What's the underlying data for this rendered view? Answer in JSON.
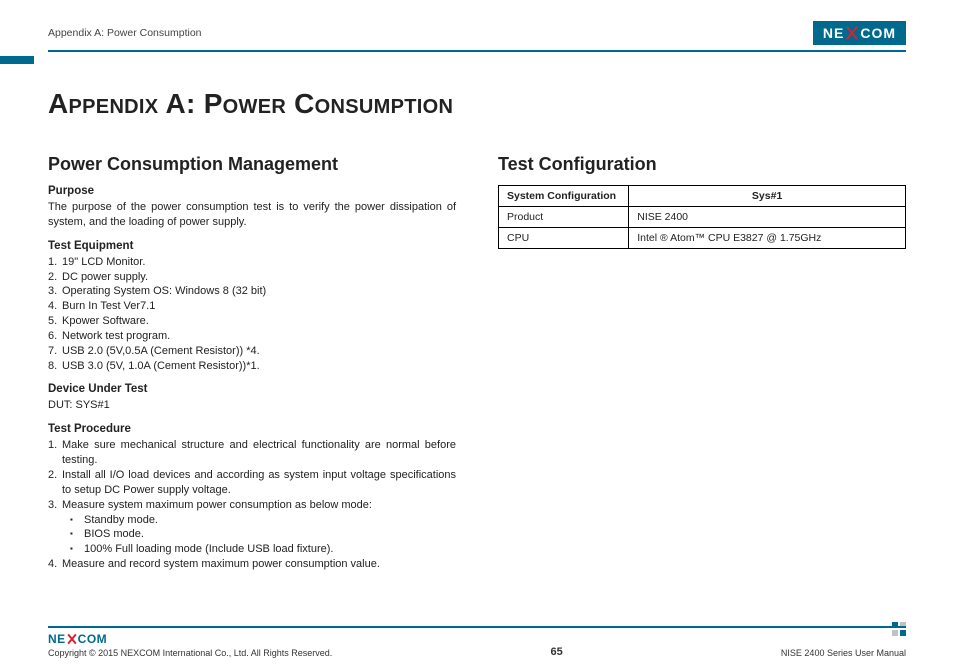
{
  "header": {
    "breadcrumb": "Appendix A: Power Consumption",
    "brand_left": "NE",
    "brand_right": "COM"
  },
  "title": "Appendix A: Power Consumption",
  "left": {
    "heading": "Power Consumption Management",
    "purpose_h": "Purpose",
    "purpose_p": "The purpose of the power consumption test is to verify the power dissipation of system, and the loading of power supply.",
    "equip_h": "Test Equipment",
    "equip": [
      "19\" LCD Monitor.",
      "DC power supply.",
      "Operating System OS: Windows 8 (32 bit)",
      "Burn In Test Ver7.1",
      "Kpower Software.",
      "Network test program.",
      "USB 2.0 (5V,0.5A (Cement Resistor)) *4.",
      "USB 3.0 (5V, 1.0A (Cement Resistor))*1."
    ],
    "dut_h": "Device Under Test",
    "dut_p": "DUT: SYS#1",
    "proc_h": "Test Procedure",
    "proc": [
      "Make sure mechanical structure and electrical functionality are normal before testing.",
      "Install all I/O load devices and according as system input voltage specifications to setup DC Power supply voltage.",
      "Measure system maximum power consumption as below mode:",
      "Measure and record system maximum power consumption value."
    ],
    "modes": [
      "Standby mode.",
      "BIOS mode.",
      "100% Full loading mode (Include USB load fixture)."
    ]
  },
  "right": {
    "heading": "Test Configuration",
    "th1": "System Configuration",
    "th2": "Sys#1",
    "rows": [
      {
        "k": "Product",
        "v": "NISE 2400"
      },
      {
        "k": "CPU",
        "v": "Intel ® Atom™ CPU E3827 @ 1.75GHz"
      }
    ]
  },
  "footer": {
    "copyright": "Copyright © 2015 NEXCOM International Co., Ltd. All Rights Reserved.",
    "page": "65",
    "manual": "NISE 2400 Series User Manual"
  }
}
